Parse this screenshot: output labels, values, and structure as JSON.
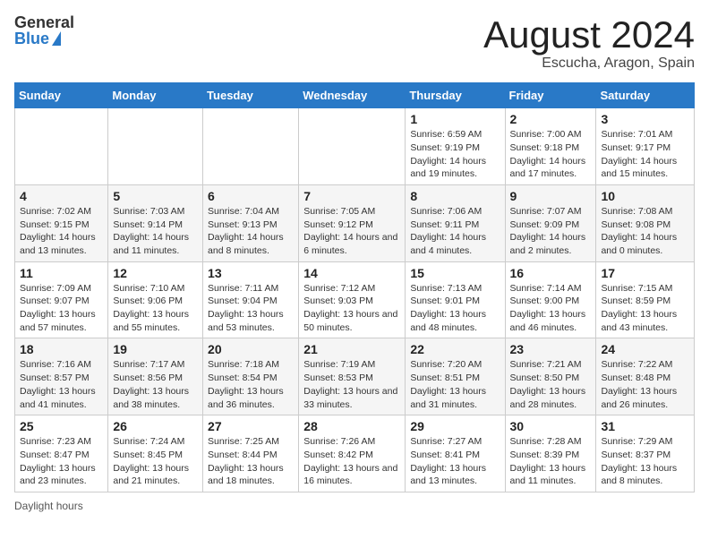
{
  "header": {
    "logo_general": "General",
    "logo_blue": "Blue",
    "title": "August 2024",
    "subtitle": "Escucha, Aragon, Spain"
  },
  "days_of_week": [
    "Sunday",
    "Monday",
    "Tuesday",
    "Wednesday",
    "Thursday",
    "Friday",
    "Saturday"
  ],
  "weeks": [
    [
      {
        "day": "",
        "info": ""
      },
      {
        "day": "",
        "info": ""
      },
      {
        "day": "",
        "info": ""
      },
      {
        "day": "",
        "info": ""
      },
      {
        "day": "1",
        "info": "Sunrise: 6:59 AM\nSunset: 9:19 PM\nDaylight: 14 hours and 19 minutes."
      },
      {
        "day": "2",
        "info": "Sunrise: 7:00 AM\nSunset: 9:18 PM\nDaylight: 14 hours and 17 minutes."
      },
      {
        "day": "3",
        "info": "Sunrise: 7:01 AM\nSunset: 9:17 PM\nDaylight: 14 hours and 15 minutes."
      }
    ],
    [
      {
        "day": "4",
        "info": "Sunrise: 7:02 AM\nSunset: 9:15 PM\nDaylight: 14 hours and 13 minutes."
      },
      {
        "day": "5",
        "info": "Sunrise: 7:03 AM\nSunset: 9:14 PM\nDaylight: 14 hours and 11 minutes."
      },
      {
        "day": "6",
        "info": "Sunrise: 7:04 AM\nSunset: 9:13 PM\nDaylight: 14 hours and 8 minutes."
      },
      {
        "day": "7",
        "info": "Sunrise: 7:05 AM\nSunset: 9:12 PM\nDaylight: 14 hours and 6 minutes."
      },
      {
        "day": "8",
        "info": "Sunrise: 7:06 AM\nSunset: 9:11 PM\nDaylight: 14 hours and 4 minutes."
      },
      {
        "day": "9",
        "info": "Sunrise: 7:07 AM\nSunset: 9:09 PM\nDaylight: 14 hours and 2 minutes."
      },
      {
        "day": "10",
        "info": "Sunrise: 7:08 AM\nSunset: 9:08 PM\nDaylight: 14 hours and 0 minutes."
      }
    ],
    [
      {
        "day": "11",
        "info": "Sunrise: 7:09 AM\nSunset: 9:07 PM\nDaylight: 13 hours and 57 minutes."
      },
      {
        "day": "12",
        "info": "Sunrise: 7:10 AM\nSunset: 9:06 PM\nDaylight: 13 hours and 55 minutes."
      },
      {
        "day": "13",
        "info": "Sunrise: 7:11 AM\nSunset: 9:04 PM\nDaylight: 13 hours and 53 minutes."
      },
      {
        "day": "14",
        "info": "Sunrise: 7:12 AM\nSunset: 9:03 PM\nDaylight: 13 hours and 50 minutes."
      },
      {
        "day": "15",
        "info": "Sunrise: 7:13 AM\nSunset: 9:01 PM\nDaylight: 13 hours and 48 minutes."
      },
      {
        "day": "16",
        "info": "Sunrise: 7:14 AM\nSunset: 9:00 PM\nDaylight: 13 hours and 46 minutes."
      },
      {
        "day": "17",
        "info": "Sunrise: 7:15 AM\nSunset: 8:59 PM\nDaylight: 13 hours and 43 minutes."
      }
    ],
    [
      {
        "day": "18",
        "info": "Sunrise: 7:16 AM\nSunset: 8:57 PM\nDaylight: 13 hours and 41 minutes."
      },
      {
        "day": "19",
        "info": "Sunrise: 7:17 AM\nSunset: 8:56 PM\nDaylight: 13 hours and 38 minutes."
      },
      {
        "day": "20",
        "info": "Sunrise: 7:18 AM\nSunset: 8:54 PM\nDaylight: 13 hours and 36 minutes."
      },
      {
        "day": "21",
        "info": "Sunrise: 7:19 AM\nSunset: 8:53 PM\nDaylight: 13 hours and 33 minutes."
      },
      {
        "day": "22",
        "info": "Sunrise: 7:20 AM\nSunset: 8:51 PM\nDaylight: 13 hours and 31 minutes."
      },
      {
        "day": "23",
        "info": "Sunrise: 7:21 AM\nSunset: 8:50 PM\nDaylight: 13 hours and 28 minutes."
      },
      {
        "day": "24",
        "info": "Sunrise: 7:22 AM\nSunset: 8:48 PM\nDaylight: 13 hours and 26 minutes."
      }
    ],
    [
      {
        "day": "25",
        "info": "Sunrise: 7:23 AM\nSunset: 8:47 PM\nDaylight: 13 hours and 23 minutes."
      },
      {
        "day": "26",
        "info": "Sunrise: 7:24 AM\nSunset: 8:45 PM\nDaylight: 13 hours and 21 minutes."
      },
      {
        "day": "27",
        "info": "Sunrise: 7:25 AM\nSunset: 8:44 PM\nDaylight: 13 hours and 18 minutes."
      },
      {
        "day": "28",
        "info": "Sunrise: 7:26 AM\nSunset: 8:42 PM\nDaylight: 13 hours and 16 minutes."
      },
      {
        "day": "29",
        "info": "Sunrise: 7:27 AM\nSunset: 8:41 PM\nDaylight: 13 hours and 13 minutes."
      },
      {
        "day": "30",
        "info": "Sunrise: 7:28 AM\nSunset: 8:39 PM\nDaylight: 13 hours and 11 minutes."
      },
      {
        "day": "31",
        "info": "Sunrise: 7:29 AM\nSunset: 8:37 PM\nDaylight: 13 hours and 8 minutes."
      }
    ]
  ],
  "footer": {
    "note": "Daylight hours"
  }
}
